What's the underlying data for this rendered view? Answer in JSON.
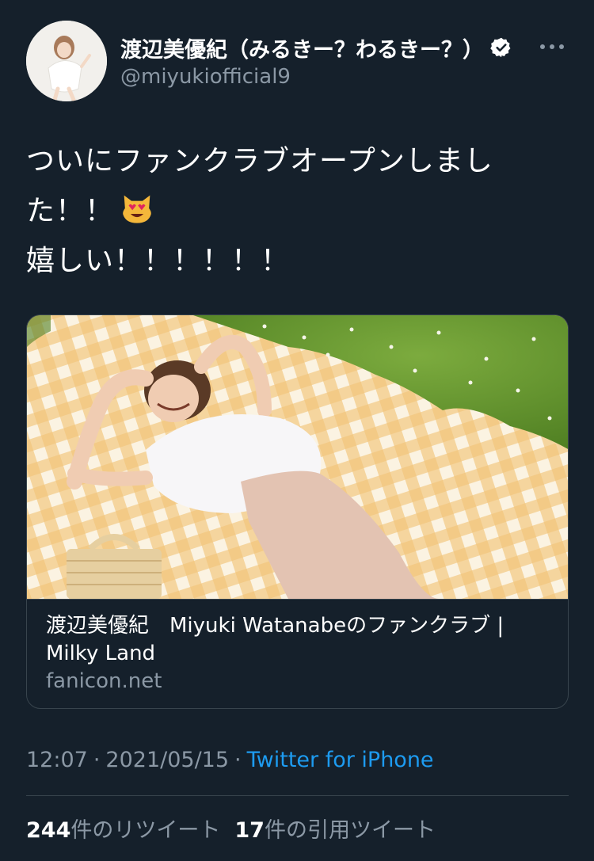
{
  "user": {
    "display_name": "渡辺美優紀（みるきー？わるきー？）",
    "handle": "@miyukiofficial9",
    "verified_icon": "verified-badge-icon",
    "more_icon": "more-dots-icon"
  },
  "tweet": {
    "lines": [
      "ついにファンクラブオープンしまし",
      "た！！",
      "嬉しい！！！！！！"
    ],
    "emoji": "smiling-cat-heart-eyes-emoji"
  },
  "card": {
    "title": "渡辺美優紀　Miyuki Watanabeのファンクラブ | Milky Land",
    "domain": "fanicon.net"
  },
  "meta": {
    "time": "12:07",
    "separator": "·",
    "date": "2021/05/15",
    "source": "Twitter for iPhone"
  },
  "stats": {
    "retweets_count": "244",
    "retweets_label": "件のリツイート",
    "quotes_count": "17",
    "quotes_label": "件の引用ツイート"
  },
  "colors": {
    "background": "#15202b",
    "secondary_text": "#8b98a5",
    "link": "#1d9bf0",
    "border": "#38444d"
  }
}
